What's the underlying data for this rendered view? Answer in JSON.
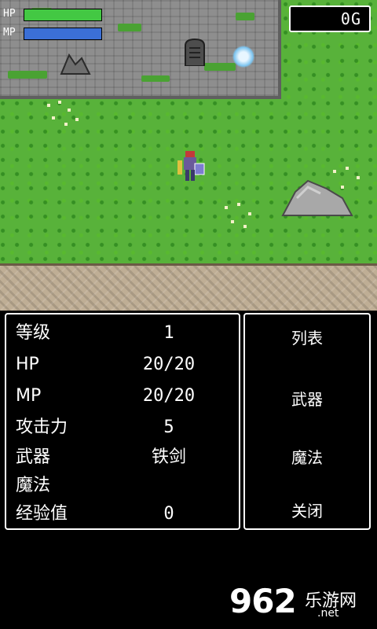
{
  "hud": {
    "hp_label": "HP",
    "mp_label": "MP",
    "hp_fraction": 1.0,
    "mp_fraction": 1.0,
    "hp_color": "#43c843",
    "mp_color": "#3b6fd6",
    "gold": "0G"
  },
  "stats": [
    {
      "name": "等级",
      "value": "1"
    },
    {
      "name": "HP",
      "value": "20/20"
    },
    {
      "name": "MP",
      "value": "20/20"
    },
    {
      "name": "攻击力",
      "value": "5"
    },
    {
      "name": "武器",
      "value": "铁剑"
    },
    {
      "name": "魔法",
      "value": ""
    },
    {
      "name": "经验值",
      "value": "0"
    }
  ],
  "menu": {
    "list": "列表",
    "weapon": "武器",
    "magic": "魔法",
    "close": "关闭"
  },
  "watermark": {
    "number": "962",
    "text": "乐游网",
    "domain": ".net"
  }
}
